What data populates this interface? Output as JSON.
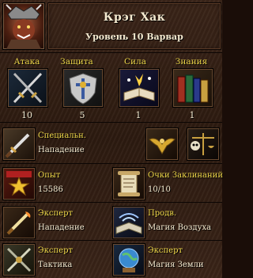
{
  "hero": {
    "name": "Крэг Хак",
    "level_line": "Уровень 10 Варвар"
  },
  "primary_stats": [
    {
      "label": "Атака",
      "value": "10",
      "icon": "sword-icon"
    },
    {
      "label": "Защита",
      "value": "5",
      "icon": "shield-icon"
    },
    {
      "label": "Сила",
      "value": "1",
      "icon": "spellbook-icon"
    },
    {
      "label": "Знания",
      "value": "1",
      "icon": "books-icon"
    }
  ],
  "specialty": {
    "title": "Специальн.",
    "value": "Нападение",
    "icon": "dagger-icon"
  },
  "misc_icons": [
    "eagle-emblem-icon",
    "skull-scales-icon"
  ],
  "experience": {
    "label": "Опыт",
    "value": "15586",
    "icon": "medal-icon"
  },
  "spell_points": {
    "label": "Очки Заклинаний",
    "value": "10/10",
    "icon": "scroll-icon"
  },
  "skills": [
    {
      "level": "Эксперт",
      "name": "Нападение",
      "icon": "flaming-sword-icon"
    },
    {
      "level": "Продв.",
      "name": "Магия Воздуха",
      "icon": "air-magic-book-icon"
    },
    {
      "level": "Эксперт",
      "name": "Тактика",
      "icon": "crossed-swords-icon"
    },
    {
      "level": "Эксперт",
      "name": "Магия Земли",
      "icon": "earth-orb-icon"
    }
  ],
  "colors": {
    "label_gold": "#f0d84a",
    "text_light": "#f4ead0",
    "panel_brown": "#2c1a10"
  }
}
